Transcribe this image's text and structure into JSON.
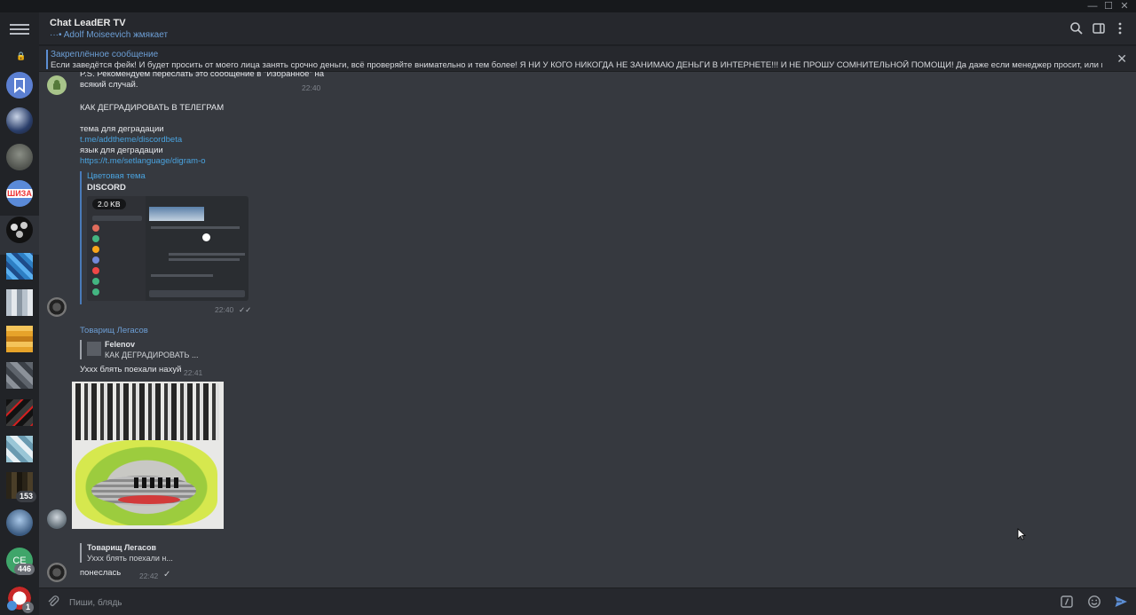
{
  "window": {
    "minimize_glyph": "—",
    "maximize_glyph": "☐",
    "close_glyph": "✕"
  },
  "sidebar": {
    "menu_icon": "hamburger-icon",
    "lock_glyph": "🔒",
    "saved_icon": "bookmark-icon",
    "chats": [
      {
        "label": "",
        "badge": ""
      },
      {
        "label": "",
        "badge": ""
      },
      {
        "label": "ШИЗА",
        "badge": ""
      },
      {
        "label": "",
        "badge": ""
      },
      {
        "label": "",
        "badge": ""
      },
      {
        "label": "",
        "badge": ""
      },
      {
        "label": "",
        "badge": ""
      },
      {
        "label": "",
        "badge": ""
      },
      {
        "label": "",
        "badge": ""
      },
      {
        "label": "",
        "badge": ""
      },
      {
        "label": "",
        "badge": "153"
      },
      {
        "label": "",
        "badge": ""
      },
      {
        "label": "СЕ",
        "badge": "446"
      },
      {
        "label": "",
        "badge": "1"
      }
    ],
    "accent": "#5b7fd1"
  },
  "header": {
    "title": "Chat LeadER TV",
    "status": "Adolf Moiseevich жмякает",
    "icons": [
      "search-icon",
      "sidebar-toggle-icon",
      "more-vertical-icon"
    ]
  },
  "pinned": {
    "title": "Закреплённое сообщение",
    "text": "Если заведётся фейк! И будет просить от моего лица занять срочно деньги, всё проверяйте внимательно и тем более! Я НИ У КОГО НИКОГДА НЕ ЗАНИМАЮ ДЕНЬГИ В ИНТЕРНЕТЕ!!! И НЕ ПРОШУ СОМНИТЕЛЬНОЙ ПОМОЩИ!  Да даже если менеджер просит, или кто-то из участников ...",
    "close_glyph": "✕"
  },
  "messages": {
    "m1": {
      "line1": "P.S. Рекомендуем переслать это сообщение в \"Избранное\" на",
      "line2": "всякий случай.",
      "time": "22:40"
    },
    "m2": {
      "heading": "КАК ДЕГРАДИРОВАТЬ В ТЕЛЕГРАМ",
      "theme_label": "тема для деградации",
      "theme_link": "t.me/addtheme/discordbeta",
      "lang_label": "язык для деградации",
      "lang_link": "https://t.me/setlanguage/digram-o",
      "preview_site": "Цветовая тема",
      "preview_title": "DISCORD",
      "preview_size": "2.0 KB",
      "time": "22:40",
      "status": "✓✓"
    },
    "m3": {
      "sender": "Товарищ Легасов",
      "reply_name": "Felenov",
      "reply_text": "КАК ДЕГРАДИРОВАТЬ ...",
      "text": "Ухxx блять поехали нахуй",
      "time": "22:41"
    },
    "m4": {
      "reply_name": "Товарищ Легасов",
      "reply_text": "Ухxx блять поехали н...",
      "text": "понеслась",
      "time": "22:42",
      "status": "✓"
    }
  },
  "composer": {
    "placeholder": "Пиши, блядь",
    "icons": [
      "attach-icon",
      "commands-icon",
      "emoji-icon",
      "send-icon"
    ]
  },
  "colors": {
    "link": "#4aa3df",
    "name": "#6d9fd6",
    "chat_bg": "#36393f"
  }
}
